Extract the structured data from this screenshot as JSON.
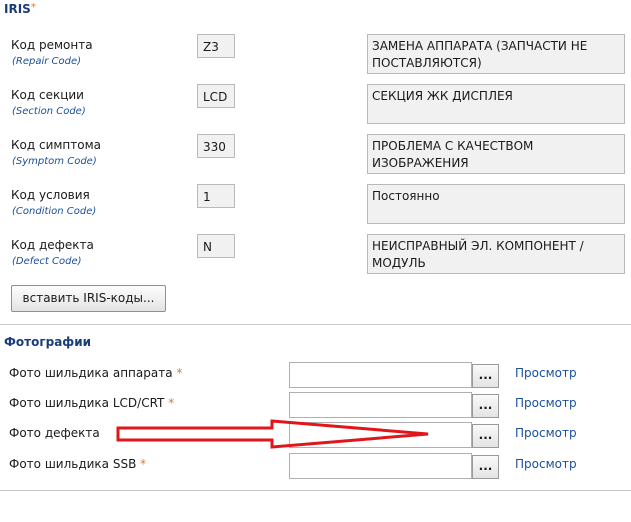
{
  "iris": {
    "title": "IRIS",
    "required_mark": "*",
    "rows": [
      {
        "label": "Код ремонта",
        "sublabel": "(Repair Code)",
        "code": "Z3",
        "description": "ЗАМЕНА АППАРАТА (ЗАПЧАСТИ НЕ ПОСТАВЛЯЮТСЯ)"
      },
      {
        "label": "Код секции",
        "sublabel": "(Section Code)",
        "code": "LCD",
        "description": "СЕКЦИЯ ЖК ДИСПЛЕЯ"
      },
      {
        "label": "Код симптома",
        "sublabel": "(Symptom Code)",
        "code": "330",
        "description": "ПРОБЛЕМА С КАЧЕСТВОМ ИЗОБРАЖЕНИЯ"
      },
      {
        "label": "Код условия",
        "sublabel": "(Condition Code)",
        "code": "1",
        "description": "Постоянно"
      },
      {
        "label": "Код дефекта",
        "sublabel": "(Defect Code)",
        "code": "N",
        "description": "НЕИСПРАВНЫЙ ЭЛ. КОМПОНЕНТ / МОДУЛЬ"
      }
    ],
    "insert_button": "вставить IRIS-коды..."
  },
  "photos": {
    "title": "Фотографии",
    "browse_label": "...",
    "view_label": "Просмотр",
    "rows": [
      {
        "label": "Фото шильдика аппарата",
        "required_mark": "*",
        "value": ""
      },
      {
        "label": "Фото шильдика LCD/CRT",
        "required_mark": "*",
        "value": ""
      },
      {
        "label": "Фото дефекта",
        "required_mark": "",
        "value": ""
      },
      {
        "label": "Фото шильдика SSB",
        "required_mark": "*",
        "value": ""
      }
    ]
  },
  "colors": {
    "accent_blue": "#1b3d7a",
    "link_blue": "#1a4f9c",
    "required_orange": "#e87722",
    "arrow_red": "#e0161b"
  }
}
